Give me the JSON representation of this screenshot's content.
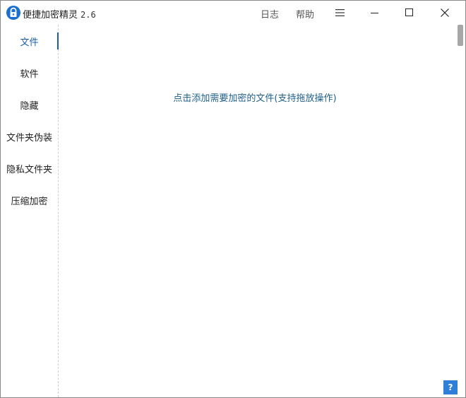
{
  "window": {
    "title": "便捷加密精灵",
    "version": "2.6"
  },
  "titlebar": {
    "log_label": "日志",
    "help_label": "帮助",
    "menu_icon": "hamburger-icon",
    "minimize_icon": "minimize-icon",
    "maximize_icon": "maximize-icon",
    "close_icon": "close-icon"
  },
  "sidebar": {
    "items": [
      {
        "label": "文件",
        "active": true
      },
      {
        "label": "软件",
        "active": false
      },
      {
        "label": "隐藏",
        "active": false
      },
      {
        "label": "文件夹伪装",
        "active": false
      },
      {
        "label": "隐私文件夹",
        "active": false
      },
      {
        "label": "压缩加密",
        "active": false
      }
    ]
  },
  "main": {
    "drop_hint": "点击添加需要加密的文件(支持拖放操作)"
  },
  "help_button": {
    "label": "?"
  },
  "colors": {
    "accent": "#1a5ea8",
    "hint_text": "#1f5f8c",
    "help_button": "#2f7fd8"
  }
}
